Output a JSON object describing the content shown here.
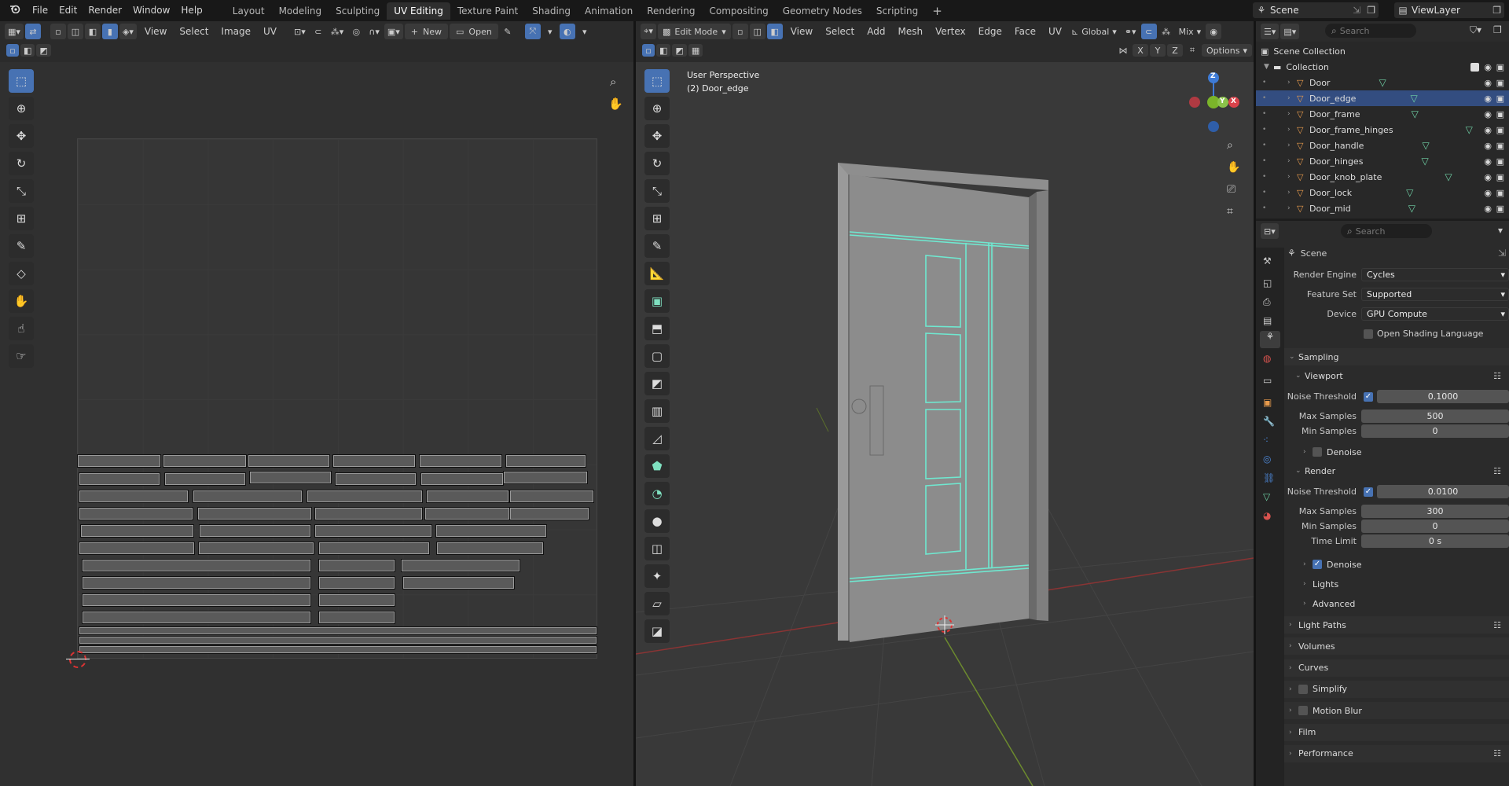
{
  "topbar": {
    "menus": [
      "File",
      "Edit",
      "Render",
      "Window",
      "Help"
    ],
    "workspaces": [
      "Layout",
      "Modeling",
      "Sculpting",
      "UV Editing",
      "Texture Paint",
      "Shading",
      "Animation",
      "Rendering",
      "Compositing",
      "Geometry Nodes",
      "Scripting"
    ],
    "active_workspace": "UV Editing",
    "add_tab": "+",
    "scene": "Scene",
    "view_layer": "ViewLayer"
  },
  "uv_editor": {
    "menus": [
      "View",
      "Select",
      "Image",
      "UV"
    ],
    "new_label": "New",
    "open_label": "Open"
  },
  "viewport": {
    "mode": "Edit Mode",
    "menus": [
      "View",
      "Select",
      "Add",
      "Mesh",
      "Vertex",
      "Edge",
      "Face",
      "UV"
    ],
    "transform_orientation": "Global",
    "overlay_mix": "Mix",
    "options_label": "Options",
    "axes": [
      "X",
      "Y",
      "Z"
    ],
    "info_line1": "User Perspective",
    "info_line2": "(2) Door_edge",
    "gizmo": {
      "x": "X",
      "y": "Y",
      "z": "Z"
    }
  },
  "outliner": {
    "search_placeholder": "Search",
    "root": "Scene Collection",
    "collection": "Collection",
    "items": [
      "Door",
      "Door_edge",
      "Door_frame",
      "Door_frame_hinges",
      "Door_handle",
      "Door_hinges",
      "Door_knob_plate",
      "Door_lock",
      "Door_mid"
    ],
    "selected": "Door_edge"
  },
  "properties": {
    "search_placeholder": "Search",
    "context": "Scene",
    "render_engine_label": "Render Engine",
    "render_engine": "Cycles",
    "feature_set_label": "Feature Set",
    "feature_set": "Supported",
    "device_label": "Device",
    "device": "GPU Compute",
    "osl_label": "Open Shading Language",
    "sampling": "Sampling",
    "viewport": "Viewport",
    "vp_noise_label": "Noise Threshold",
    "vp_noise": "0.1000",
    "vp_max_label": "Max Samples",
    "vp_max": "500",
    "vp_min_label": "Min Samples",
    "vp_min": "0",
    "vp_denoise": "Denoise",
    "render": "Render",
    "r_noise_label": "Noise Threshold",
    "r_noise": "0.0100",
    "r_max_label": "Max Samples",
    "r_max": "300",
    "r_min_label": "Min Samples",
    "r_min": "0",
    "r_time_label": "Time Limit",
    "r_time": "0 s",
    "r_denoise": "Denoise",
    "lights": "Lights",
    "advanced": "Advanced",
    "panels": [
      "Light Paths",
      "Volumes",
      "Curves",
      "Simplify",
      "Motion Blur",
      "Film",
      "Performance"
    ]
  },
  "colors": {
    "accent": "#4772b3",
    "selected_row": "#334d80",
    "object_icon": "#e79a4c",
    "mesh_icon": "#6fd1a6",
    "edge_highlight": "#6fe8d0"
  }
}
